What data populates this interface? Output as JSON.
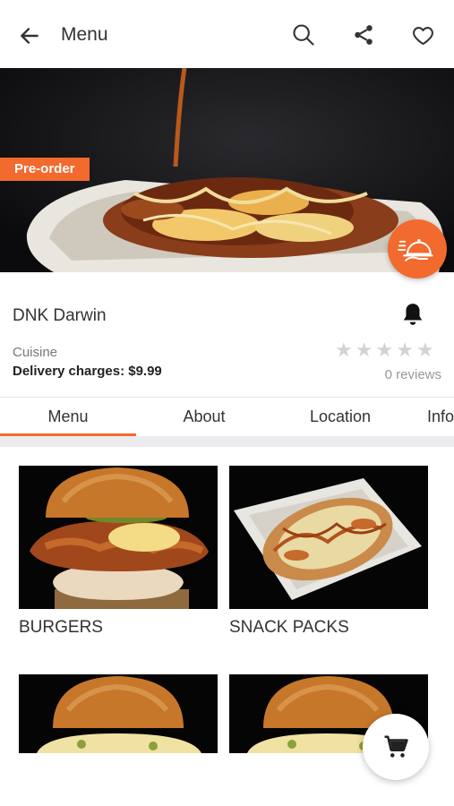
{
  "header": {
    "title": "Menu",
    "icons": [
      "arrow-left-icon",
      "search-icon",
      "share-icon",
      "heart-icon"
    ]
  },
  "hero": {
    "badge": "Pre-order",
    "fab_icon": "food-delivery-icon"
  },
  "restaurant": {
    "name": "DNK Darwin",
    "cuisine_label": "Cuisine",
    "delivery_charges": "Delivery charges: $9.99",
    "rating": 0,
    "max_rating": 5,
    "reviews": "0 reviews"
  },
  "tabs": [
    {
      "label": "Menu",
      "active": true
    },
    {
      "label": "About",
      "active": false
    },
    {
      "label": "Location",
      "active": false
    },
    {
      "label": "Info",
      "active": false
    }
  ],
  "categories": [
    {
      "label": "BURGERS"
    },
    {
      "label": "SNACK PACKS"
    },
    {
      "label": ""
    },
    {
      "label": ""
    }
  ],
  "colors": {
    "accent": "#f26a2e",
    "separator": "#ececef"
  },
  "cart": {
    "icon": "cart-icon"
  }
}
